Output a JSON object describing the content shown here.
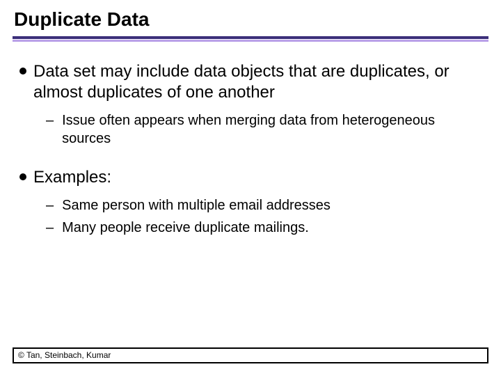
{
  "title": "Duplicate Data",
  "bullets": [
    {
      "text": "Data set may include data objects that are duplicates, or almost duplicates of one another",
      "sub": [
        "Issue often appears when merging data from heterogeneous sources"
      ]
    },
    {
      "text": "Examples:",
      "sub": [
        "Same person with multiple email addresses",
        "Many people receive duplicate mailings."
      ]
    }
  ],
  "footer": "© Tan, Steinbach, Kumar"
}
